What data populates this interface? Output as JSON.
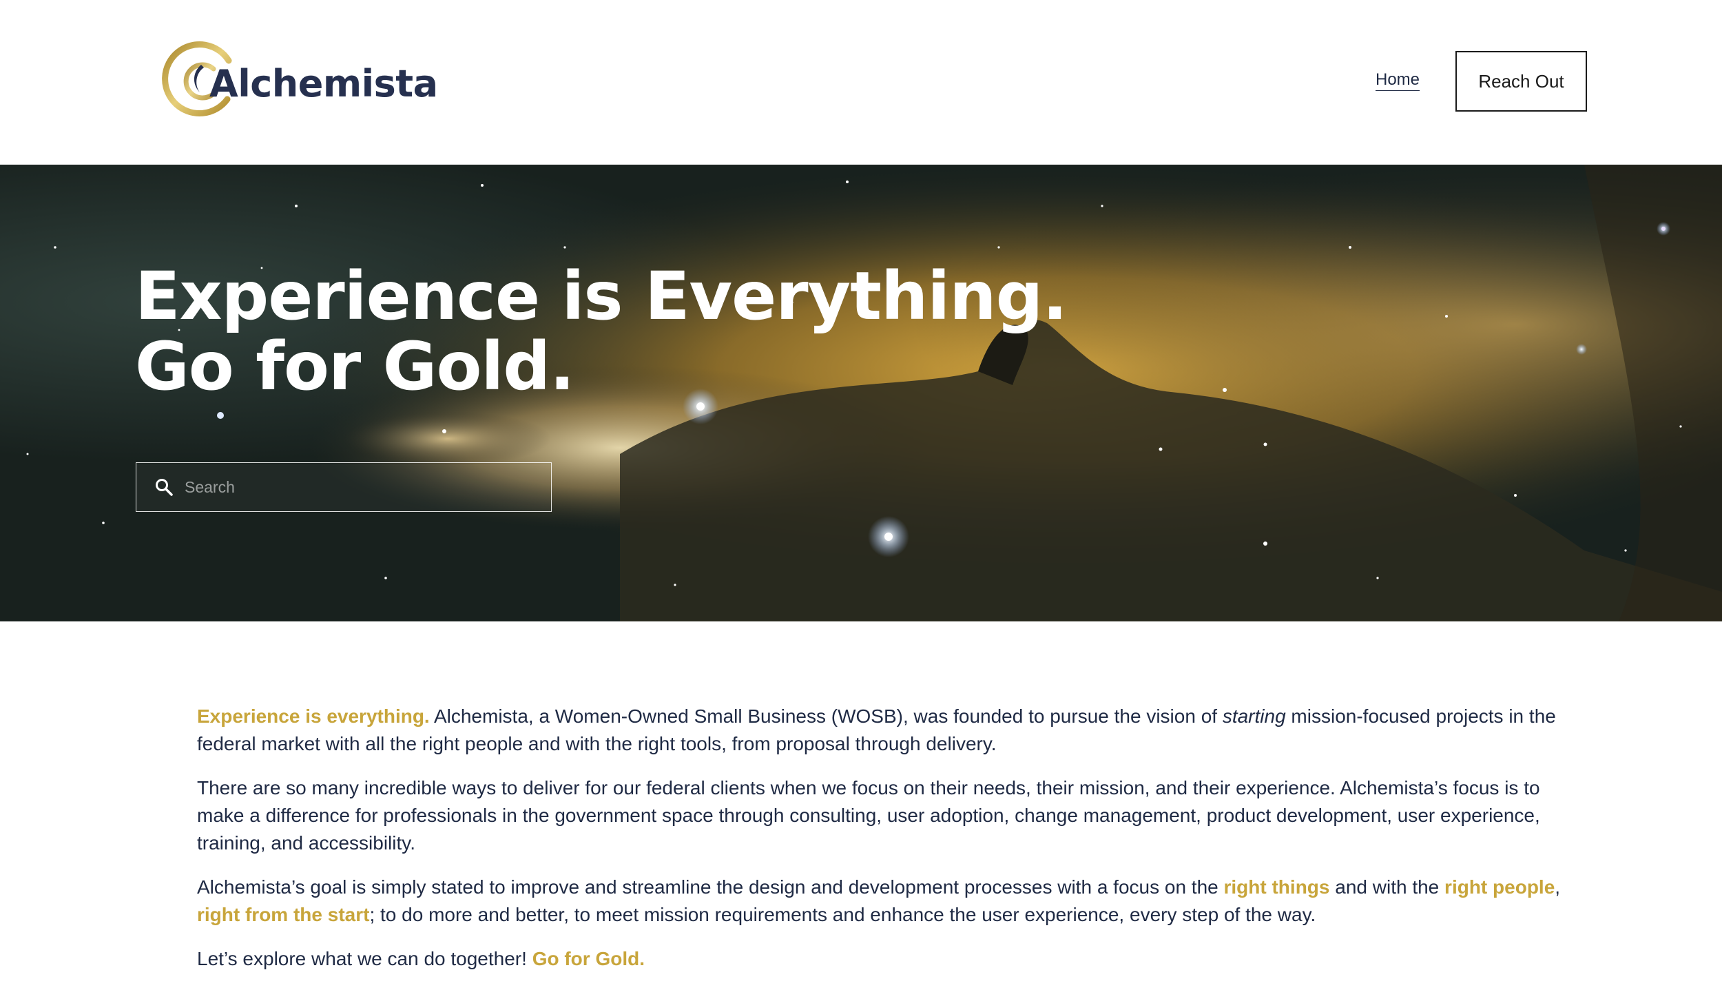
{
  "header": {
    "logo_text": "Alchemista",
    "nav_home": "Home",
    "cta_label": "Reach Out"
  },
  "hero": {
    "title_line1": "Experience is Everything.",
    "title_line2": "Go for Gold.",
    "search_placeholder": "Search"
  },
  "content": {
    "p1": {
      "lead": "Experience is everything.",
      "text_a": " Alchemista, a Women-Owned Small Business (WOSB), was founded to pursue the vision of ",
      "em": "starting",
      "text_b": " mission-focused projects in the federal market with all the right people and with the right tools, from proposal through delivery."
    },
    "p2": "There are so many incredible ways to deliver for our federal clients when we focus on their needs, their mission, and their experience. Alchemista’s focus is to make a difference for professionals in the government space through consulting, user adoption, change management, product development, user experience, training, and accessibility.",
    "p3": {
      "text_a": "Alchemista’s goal is simply stated to improve and streamline the design and development processes with a focus on the ",
      "gold_a": "right things",
      "text_b": " and with the ",
      "gold_b": "right people",
      "text_c": ", ",
      "gold_c": "right from the start",
      "text_d": "; to do more and better, to meet mission requirements and enhance the user experience, every step of the way."
    },
    "p4": {
      "text_a": "Let’s explore what we can do together! ",
      "gold": "Go for Gold."
    }
  },
  "colors": {
    "gold_accent": "#c8a53b",
    "navy_text": "#1f2a44",
    "hero_gold": "#d9a93a",
    "hero_dark": "#1b2420"
  }
}
